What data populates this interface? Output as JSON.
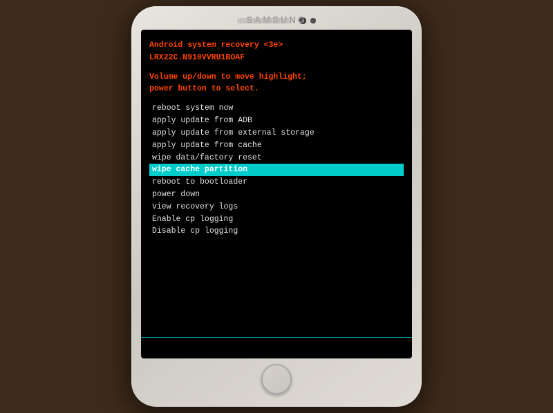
{
  "phone": {
    "brand": "SAMSUNG",
    "recovery": {
      "title_line1": "Android system recovery <3e>",
      "title_line2": "LRX22C.N910VVRU1BOAF",
      "instruction_line1": "Volume up/down to move highlight;",
      "instruction_line2": "power button to select.",
      "menu_items": [
        {
          "id": "reboot-system",
          "label": "reboot system now",
          "highlighted": false
        },
        {
          "id": "apply-adb",
          "label": "apply update from ADB",
          "highlighted": false
        },
        {
          "id": "apply-external",
          "label": "apply update from external storage",
          "highlighted": false
        },
        {
          "id": "apply-cache",
          "label": "apply update from cache",
          "highlighted": false
        },
        {
          "id": "wipe-data",
          "label": "wipe data/factory reset",
          "highlighted": false
        },
        {
          "id": "wipe-cache",
          "label": "wipe cache partition",
          "highlighted": true
        },
        {
          "id": "reboot-bootloader",
          "label": "reboot to bootloader",
          "highlighted": false
        },
        {
          "id": "power-down",
          "label": "power down",
          "highlighted": false
        },
        {
          "id": "view-logs",
          "label": "view recovery logs",
          "highlighted": false
        },
        {
          "id": "enable-cp",
          "label": "Enable cp logging",
          "highlighted": false
        },
        {
          "id": "disable-cp",
          "label": "Disable cp logging",
          "highlighted": false
        }
      ]
    }
  }
}
